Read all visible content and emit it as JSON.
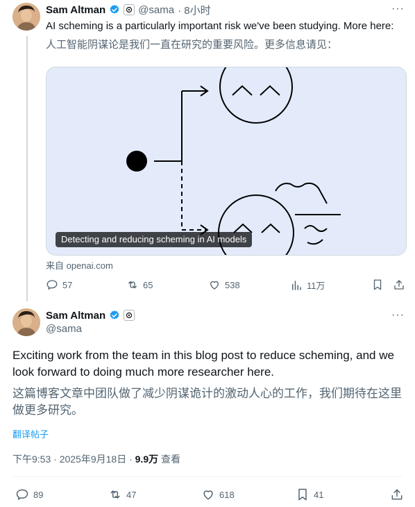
{
  "tweet1": {
    "name": "Sam Altman",
    "handle": "@sama",
    "time": "· 8小时",
    "text": "AI scheming is a particularly important risk we've been studying. More here:",
    "translation": "人工智能阴谋论是我们一直在研究的重要风险。更多信息请见：",
    "card_caption": "Detecting and reducing scheming in AI models",
    "card_source": "来自 openai.com",
    "actions": {
      "replies": "57",
      "retweets": "65",
      "likes": "538",
      "views": "11万"
    }
  },
  "tweet2": {
    "name": "Sam Altman",
    "handle": "@sama",
    "text": "Exciting work from the team in this blog post to reduce scheming, and we look forward to doing much more researcher here.",
    "translation": "这篇博客文章中团队做了减少阴谋诡计的激动人心的工作，我们期待在这里做更多研究。",
    "translate_link": "翻译帖子",
    "timestamp": "下午9:53 · 2025年9月18日 · ",
    "views_count": "9.9万",
    "views_label": " 查看",
    "actions": {
      "replies": "89",
      "retweets": "47",
      "likes": "618",
      "bookmarks": "41"
    }
  },
  "colors": {
    "verified_blue": "#1d9bf0",
    "text": "#0f1419",
    "muted": "#536471",
    "card_bg": "#e3ebfb"
  },
  "icons": [
    "verified-icon",
    "org-badge-icon",
    "more-icon",
    "reply-icon",
    "retweet-icon",
    "like-icon",
    "views-icon",
    "bookmark-icon",
    "share-icon"
  ]
}
